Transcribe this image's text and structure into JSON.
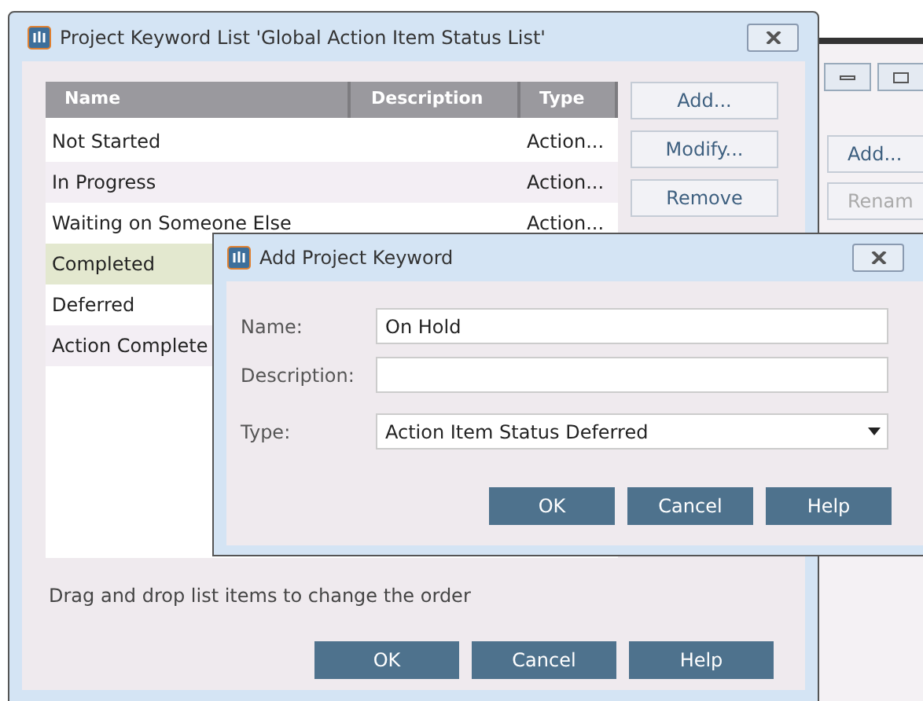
{
  "background_window": {
    "buttons": [
      {
        "label": "Add...",
        "disabled": false
      },
      {
        "label": "Renam",
        "disabled": true
      }
    ]
  },
  "keyword_list_dialog": {
    "title": "Project Keyword List 'Global Action Item Status List'",
    "table": {
      "columns": [
        "Name",
        "Description",
        "Type"
      ],
      "rows": [
        {
          "name": "Not Started",
          "type": "Action...",
          "selected": false
        },
        {
          "name": "In Progress",
          "type": "Action...",
          "selected": false
        },
        {
          "name": "Waiting on Someone Else",
          "type": "Action...",
          "selected": false
        },
        {
          "name": "Completed",
          "selected": true
        },
        {
          "name": "Deferred",
          "selected": false
        },
        {
          "name": "Action Complete",
          "selected": false
        }
      ]
    },
    "side_buttons": [
      "Add...",
      "Modify...",
      "Remove"
    ],
    "hint": "Drag and drop list items to change the order",
    "buttons": [
      "OK",
      "Cancel",
      "Help"
    ]
  },
  "add_keyword_dialog": {
    "title": "Add Project Keyword",
    "fields": [
      {
        "label": "Name:",
        "kind": "text",
        "value": "On Hold"
      },
      {
        "label": "Description:",
        "kind": "text"
      },
      {
        "label": "Type:",
        "kind": "dropdown",
        "value": "Action Item Status Deferred"
      }
    ],
    "buttons": [
      "OK",
      "Cancel",
      "Help"
    ]
  }
}
